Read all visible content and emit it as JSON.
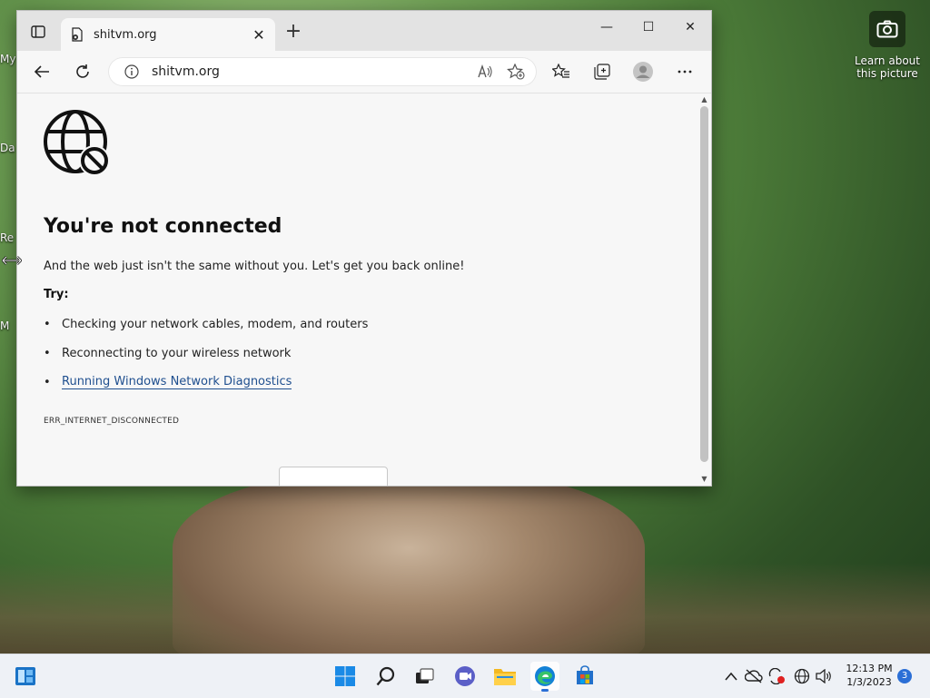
{
  "desktop": {
    "camera_label": "Learn about this picture",
    "side_labels": [
      "My",
      "Da",
      "Re",
      "M"
    ]
  },
  "browser": {
    "tab": {
      "title": "shitvm.org"
    },
    "address": {
      "url": "shitvm.org"
    },
    "page": {
      "title": "You're not connected",
      "description": "And the web just isn't the same without you. Let's get you back online!",
      "try_label": "Try:",
      "suggestions": [
        "Checking your network cables, modem, and routers",
        "Reconnecting to your wireless network",
        "Running Windows Network Diagnostics"
      ],
      "error_code": "ERR_INTERNET_DISCONNECTED"
    }
  },
  "taskbar": {
    "clock_time": "12:13 PM",
    "clock_date": "1/3/2023",
    "notification_count": "3"
  },
  "colors": {
    "accent": "#2b6fd6",
    "link": "#1f4f8f"
  }
}
